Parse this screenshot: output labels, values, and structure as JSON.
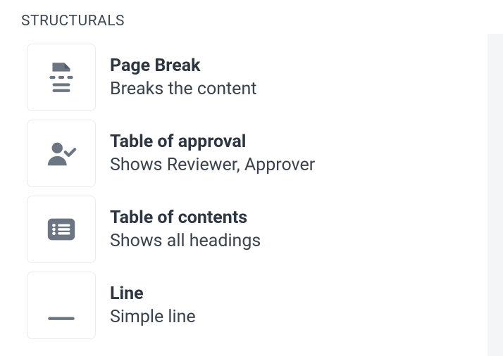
{
  "section": {
    "header": "STRUCTURALS",
    "items": [
      {
        "title": "Page Break",
        "description": "Breaks the content"
      },
      {
        "title": "Table of approval",
        "description": "Shows Reviewer, Approver"
      },
      {
        "title": "Table of contents",
        "description": "Shows all headings"
      },
      {
        "title": "Line",
        "description": "Simple line"
      }
    ]
  }
}
